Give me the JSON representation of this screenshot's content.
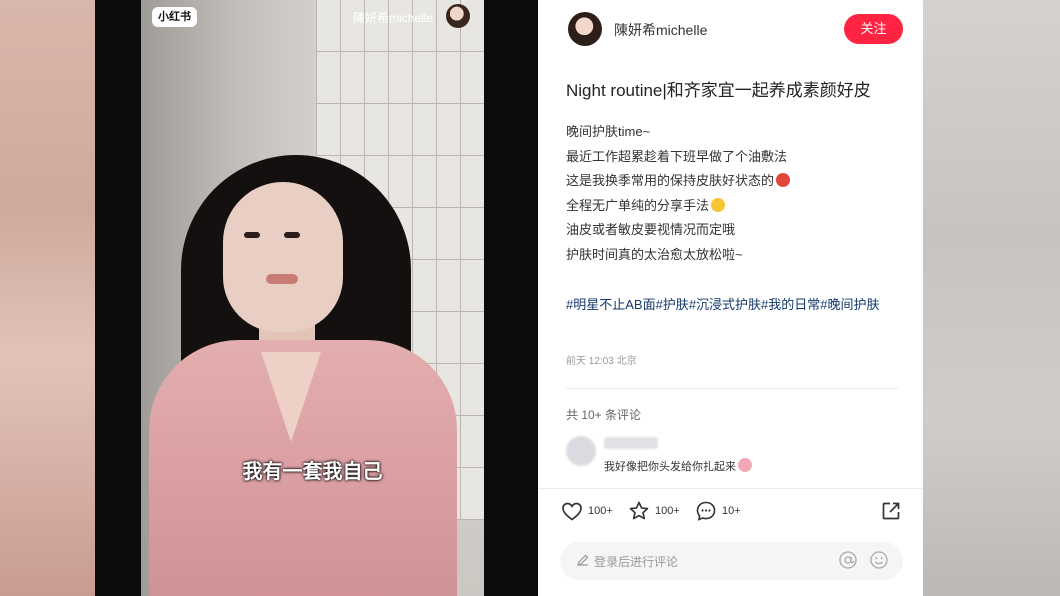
{
  "video": {
    "app_logo": "小红书",
    "username": "陳妍希michelle",
    "caption": "我有一套我自己"
  },
  "post": {
    "author": "陳妍希michelle",
    "follow_label": "关注",
    "title": "Night routine|和齐家宜一起养成素颜好皮",
    "body_lines": [
      "晚间护肤time~",
      "最近工作超累趁着下班早做了个油敷法",
      "这是我换季常用的保持皮肤好状态的",
      "全程无广单纯的分享手法",
      "油皮或者敏皮要视情况而定哦",
      "护肤时间真的太治愈太放松啦~"
    ],
    "tags": [
      "#明星不止AB面",
      "#护肤",
      "#沉浸式护肤",
      "#我的日常",
      "#晚间护肤"
    ],
    "date": "前天 12:03 北京"
  },
  "comments": {
    "count_label": "共 10+ 条评论",
    "first_comment_text": "我好像把你头发给你扎起来"
  },
  "actions": {
    "like_count": "100+",
    "star_count": "100+",
    "comment_count": "10+"
  },
  "comment_input": {
    "placeholder": "登录后进行评论"
  },
  "colors": {
    "accent": "#ff2442",
    "tag": "#13386c"
  }
}
